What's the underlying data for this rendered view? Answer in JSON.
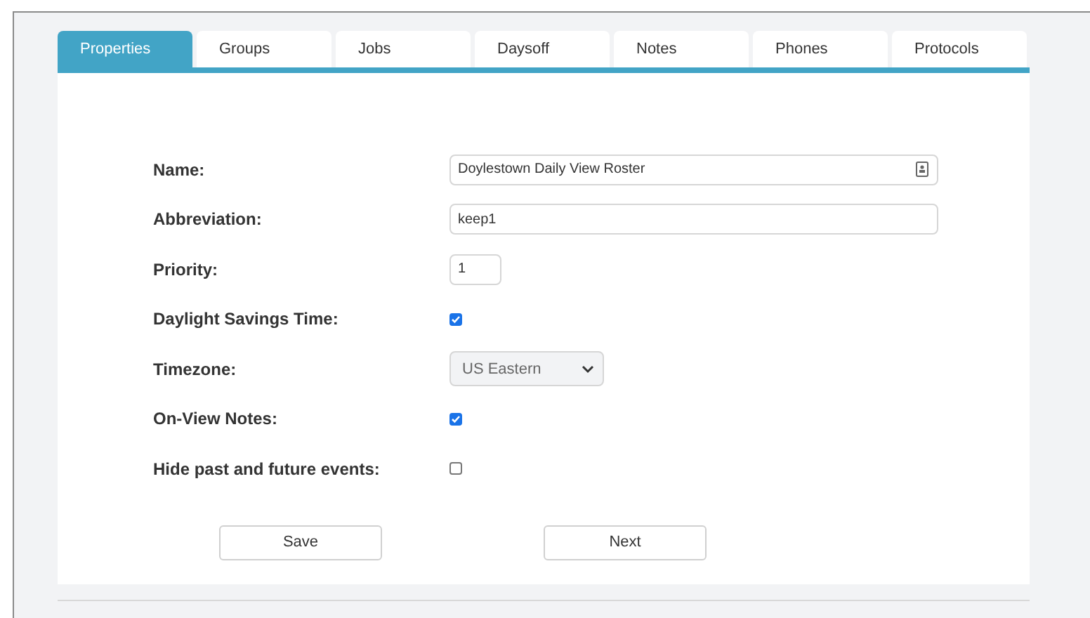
{
  "tabs": [
    {
      "label": "Properties",
      "selected": true
    },
    {
      "label": "Groups",
      "selected": false
    },
    {
      "label": "Jobs",
      "selected": false
    },
    {
      "label": "Daysoff",
      "selected": false
    },
    {
      "label": "Notes",
      "selected": false
    },
    {
      "label": "Phones",
      "selected": false
    },
    {
      "label": "Protocols",
      "selected": false
    }
  ],
  "fields": [
    {
      "kind": "text",
      "label": "Name:",
      "value": "Doylestown Daily View Roster",
      "icon": true
    },
    {
      "kind": "text",
      "label": "Abbreviation:",
      "value": "keep1"
    },
    {
      "kind": "short",
      "label": "Priority:",
      "value": "1"
    },
    {
      "kind": "checkbox",
      "label": "Daylight Savings Time:",
      "checked": true
    },
    {
      "kind": "select",
      "label": "Timezone:",
      "value": "US Eastern"
    },
    {
      "kind": "checkbox",
      "label": "On-View Notes:",
      "checked": true
    },
    {
      "kind": "checkbox",
      "label": "Hide past and future events:",
      "checked": false
    }
  ],
  "buttons": [
    "Save",
    "Next"
  ]
}
